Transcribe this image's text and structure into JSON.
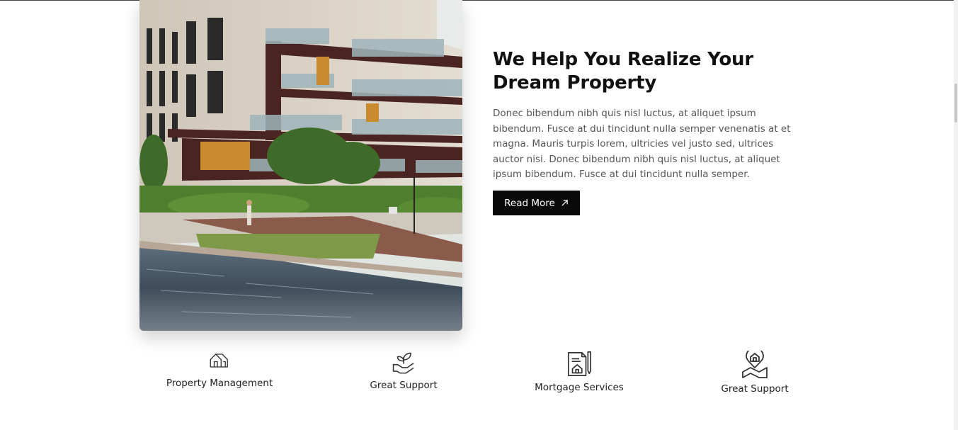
{
  "about": {
    "heading": "We Help You Realize Your Dream Property",
    "paragraph": "Donec bibendum nibh quis nisl luctus, at aliquet ipsum bibendum. Fusce at dui tincidunt nulla semper venenatis at et magna. Mauris turpis lorem, ultricies vel justo sed, ultrices auctor nisi. Donec bibendum nibh quis nisl luctus, at aliquet ipsum bibendum. Fusce at dui tincidunt nulla semper.",
    "cta_label": "Read More"
  },
  "features": [
    {
      "label": "Property Management",
      "icon": "house-outline-icon"
    },
    {
      "label": "Great Support",
      "icon": "hand-plant-icon"
    },
    {
      "label": "Mortgage Services",
      "icon": "document-pen-icon"
    },
    {
      "label": "Great Support",
      "icon": "house-location-pin-icon"
    }
  ],
  "colors": {
    "button_bg": "#0a0a0a",
    "heading": "#111111",
    "body_text": "#555555"
  }
}
